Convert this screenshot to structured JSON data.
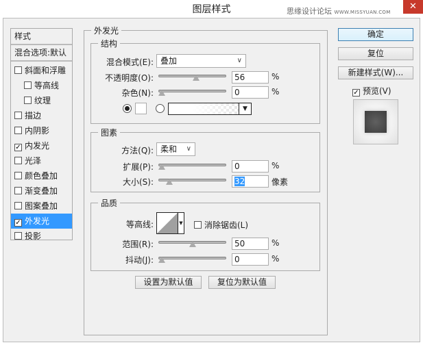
{
  "window": {
    "title": "图层样式",
    "close": "✕",
    "watermark_cn": "思缘设计论坛",
    "watermark_url": "WWW.MISSYUAN.COM"
  },
  "sidebar": {
    "header": "样式",
    "blend_options": "混合选项:默认",
    "items": [
      {
        "label": "斜面和浮雕",
        "checked": false,
        "indent": false,
        "selected": false
      },
      {
        "label": "等高线",
        "checked": false,
        "indent": true,
        "selected": false
      },
      {
        "label": "纹理",
        "checked": false,
        "indent": true,
        "selected": false
      },
      {
        "label": "描边",
        "checked": false,
        "indent": false,
        "selected": false
      },
      {
        "label": "内阴影",
        "checked": false,
        "indent": false,
        "selected": false
      },
      {
        "label": "内发光",
        "checked": true,
        "indent": false,
        "selected": false
      },
      {
        "label": "光泽",
        "checked": false,
        "indent": false,
        "selected": false
      },
      {
        "label": "颜色叠加",
        "checked": false,
        "indent": false,
        "selected": false
      },
      {
        "label": "渐变叠加",
        "checked": false,
        "indent": false,
        "selected": false
      },
      {
        "label": "图案叠加",
        "checked": false,
        "indent": false,
        "selected": false
      },
      {
        "label": "外发光",
        "checked": true,
        "indent": false,
        "selected": true
      },
      {
        "label": "投影",
        "checked": false,
        "indent": false,
        "selected": false
      }
    ]
  },
  "main": {
    "title": "外发光",
    "structure": {
      "title": "结构",
      "blend_mode_label": "混合模式(E):",
      "blend_mode": "叠加",
      "opacity_label": "不透明度(O):",
      "opacity": "56",
      "noise_label": "杂色(N):",
      "noise": "0",
      "unit": "%",
      "opacity_value": 56,
      "noise_value": 0
    },
    "elements": {
      "title": "图素",
      "method_label": "方法(Q):",
      "method": "柔和",
      "spread_label": "扩展(P):",
      "spread": "0",
      "size_label": "大小(S):",
      "size": "32",
      "size_unit": "像素",
      "spread_value": 0,
      "size_value": 32,
      "size_max": 250
    },
    "quality": {
      "title": "品质",
      "contour_label": "等高线:",
      "antialias_label": "消除锯齿(L)",
      "antialias": false,
      "range_label": "范围(R):",
      "range": "50",
      "jitter_label": "抖动(J):",
      "jitter": "0",
      "range_value": 50,
      "jitter_value": 0
    },
    "make_default": "设置为默认值",
    "reset_default": "复位为默认值"
  },
  "right": {
    "ok": "确定",
    "reset": "复位",
    "new_style": "新建样式(W)...",
    "preview_label": "预览(V)",
    "preview": true
  }
}
